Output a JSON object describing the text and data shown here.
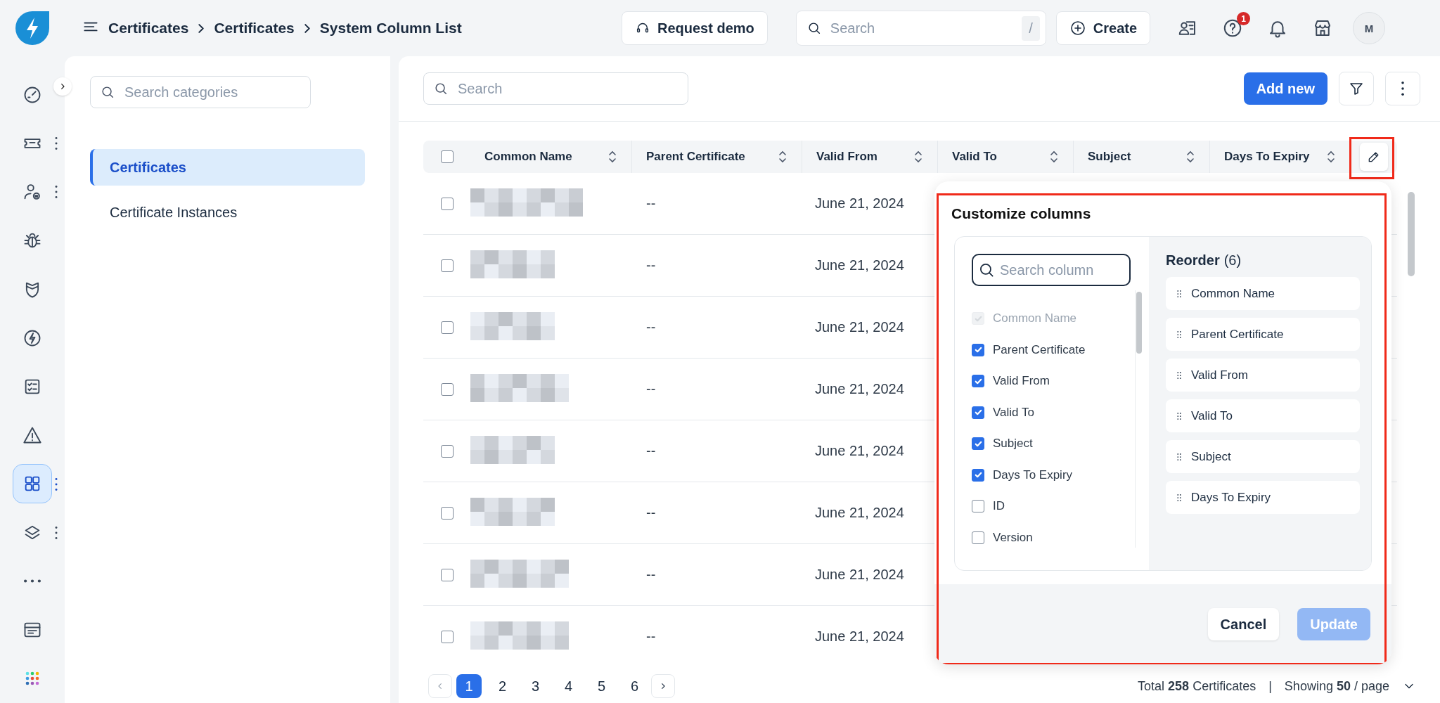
{
  "breadcrumb": [
    "Certificates",
    "Certificates",
    "System Column List"
  ],
  "header": {
    "demo_button": "Request demo",
    "search": {
      "placeholder": "Search",
      "shortcut": "/"
    },
    "create_button": "Create",
    "help_badge": "1",
    "avatar": "M"
  },
  "rail": [
    {
      "selected": false,
      "menu": false
    },
    {
      "selected": false,
      "menu": true
    },
    {
      "selected": false,
      "menu": true
    },
    {
      "selected": false,
      "menu": false
    },
    {
      "selected": false,
      "menu": false
    },
    {
      "selected": false,
      "menu": false
    },
    {
      "selected": false,
      "menu": false
    },
    {
      "selected": false,
      "menu": false
    },
    {
      "selected": true,
      "menu": true
    },
    {
      "selected": false,
      "menu": true
    },
    {
      "selected": false,
      "menu": false
    },
    {
      "selected": false,
      "menu": false
    },
    {
      "selected": false,
      "menu": false
    }
  ],
  "categories": {
    "search": {
      "placeholder": "Search categories"
    },
    "items": [
      {
        "label": "Certificates",
        "selected": true
      },
      {
        "label": "Certificate Instances",
        "selected": false
      }
    ]
  },
  "toolbar": {
    "search": {
      "placeholder": "Search"
    },
    "add_button": "Add new"
  },
  "table": {
    "select_all_checked": false,
    "columns": [
      "Common Name",
      "Parent Certificate",
      "Valid From",
      "Valid To",
      "Subject",
      "Days To Expiry"
    ],
    "rows": [
      {
        "checked": false,
        "parent_certificate": "--",
        "valid_from": "June 21, 2024"
      },
      {
        "checked": false,
        "parent_certificate": "--",
        "valid_from": "June 21, 2024"
      },
      {
        "checked": false,
        "parent_certificate": "--",
        "valid_from": "June 21, 2024"
      },
      {
        "checked": false,
        "parent_certificate": "--",
        "valid_from": "June 21, 2024"
      },
      {
        "checked": false,
        "parent_certificate": "--",
        "valid_from": "June 21, 2024"
      },
      {
        "checked": false,
        "parent_certificate": "--",
        "valid_from": "June 21, 2024"
      },
      {
        "checked": false,
        "parent_certificate": "--",
        "valid_from": "June 21, 2024"
      },
      {
        "checked": false,
        "parent_certificate": "--",
        "valid_from": "June 21, 2024"
      }
    ]
  },
  "pagination": {
    "pages": [
      {
        "label": "1",
        "selected": true
      },
      {
        "label": "2",
        "selected": false
      },
      {
        "label": "3",
        "selected": false
      },
      {
        "label": "4",
        "selected": false
      },
      {
        "label": "5",
        "selected": false
      },
      {
        "label": "6",
        "selected": false
      }
    ],
    "total": "Total **258** Certificates",
    "separator": "|",
    "showing": "Showing **50** / page"
  },
  "customize": {
    "title": "Customize columns",
    "search": {
      "placeholder": "Search column"
    },
    "options": [
      {
        "label": "Common Name",
        "checked": true,
        "disabled": true
      },
      {
        "label": "Parent Certificate",
        "checked": true,
        "disabled": false
      },
      {
        "label": "Valid From",
        "checked": true,
        "disabled": false
      },
      {
        "label": "Valid To",
        "checked": true,
        "disabled": false
      },
      {
        "label": "Subject",
        "checked": true,
        "disabled": false
      },
      {
        "label": "Days To Expiry",
        "checked": true,
        "disabled": false
      },
      {
        "label": "ID",
        "checked": false,
        "disabled": false
      },
      {
        "label": "Version",
        "checked": false,
        "disabled": false
      }
    ],
    "reorder_title": "Reorder",
    "reorder_count": "(6)",
    "reorder_items": [
      "Common Name",
      "Parent Certificate",
      "Valid From",
      "Valid To",
      "Subject",
      "Days To Expiry"
    ],
    "cancel_button": "Cancel",
    "update_button": {
      "label": "Update",
      "disabled": true
    }
  }
}
